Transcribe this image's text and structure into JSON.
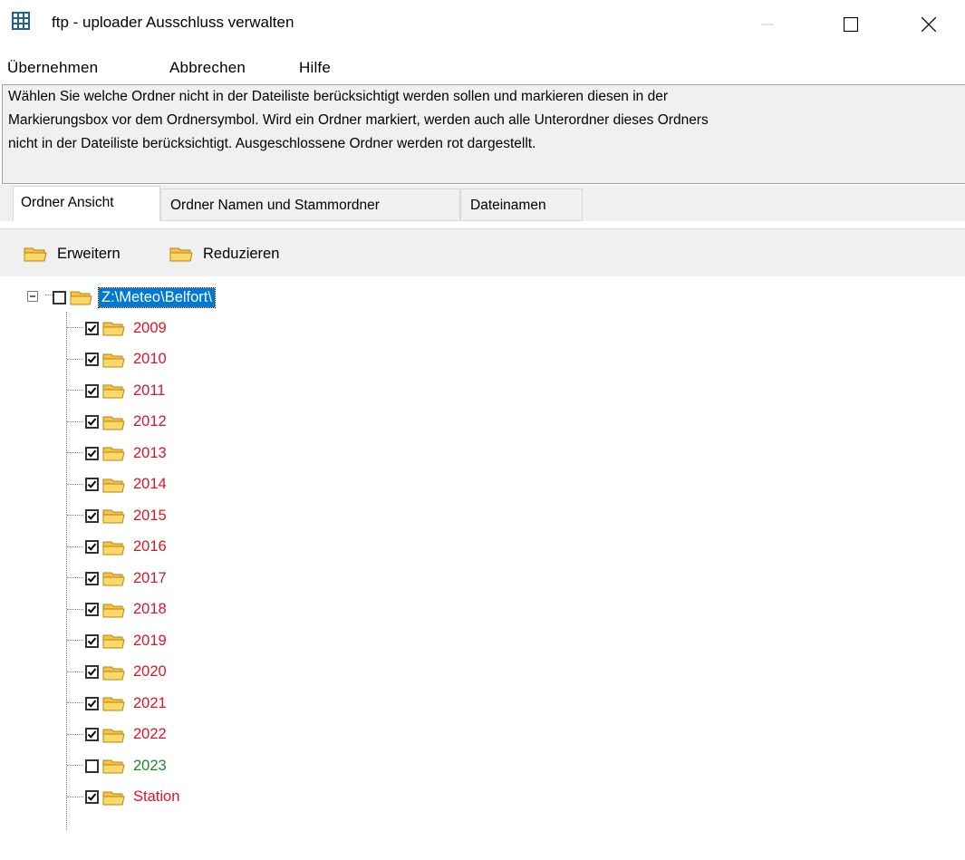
{
  "window": {
    "title": "ftp - uploader  Ausschluss verwalten",
    "minimize_label": "—",
    "colors": {
      "excluded": "#e81123",
      "included": "#1a8a2a",
      "selection": "#0078d7"
    }
  },
  "menu": [
    "Übernehmen",
    "Abbrechen",
    "Hilfe"
  ],
  "description": [
    "Wählen Sie welche Ordner nicht in der Dateiliste berücksichtigt werden sollen und markieren diesen in der",
    "Markierungsbox vor dem Ordnersymbol. Wird ein Ordner markiert, werden auch alle Unterordner dieses Ordners",
    "nicht in der Dateiliste berücksichtigt. Ausgeschlossene Ordner werden rot dargestellt."
  ],
  "tabs": [
    "Ordner Ansicht",
    "Ordner Namen und Stammordner",
    "Dateinamen"
  ],
  "active_tab": "Ordner Ansicht",
  "toolbar": {
    "expand_label": "Erweitern",
    "collapse_label": "Reduzieren"
  },
  "tree": {
    "root": {
      "label": "Z:\\Meteo\\Belfort\\",
      "checked": false,
      "expanded": true,
      "selected": true
    },
    "children": [
      {
        "label": "2009",
        "checked": true,
        "status": "excluded"
      },
      {
        "label": "2010",
        "checked": true,
        "status": "excluded"
      },
      {
        "label": "2011",
        "checked": true,
        "status": "excluded"
      },
      {
        "label": "2012",
        "checked": true,
        "status": "excluded"
      },
      {
        "label": "2013",
        "checked": true,
        "status": "excluded"
      },
      {
        "label": "2014",
        "checked": true,
        "status": "excluded"
      },
      {
        "label": "2015",
        "checked": true,
        "status": "excluded"
      },
      {
        "label": "2016",
        "checked": true,
        "status": "excluded"
      },
      {
        "label": "2017",
        "checked": true,
        "status": "excluded"
      },
      {
        "label": "2018",
        "checked": true,
        "status": "excluded"
      },
      {
        "label": "2019",
        "checked": true,
        "status": "excluded"
      },
      {
        "label": "2020",
        "checked": true,
        "status": "excluded"
      },
      {
        "label": "2021",
        "checked": true,
        "status": "excluded"
      },
      {
        "label": "2022",
        "checked": true,
        "status": "excluded"
      },
      {
        "label": "2023",
        "checked": false,
        "status": "included"
      },
      {
        "label": "Station",
        "checked": true,
        "status": "excluded"
      }
    ]
  }
}
